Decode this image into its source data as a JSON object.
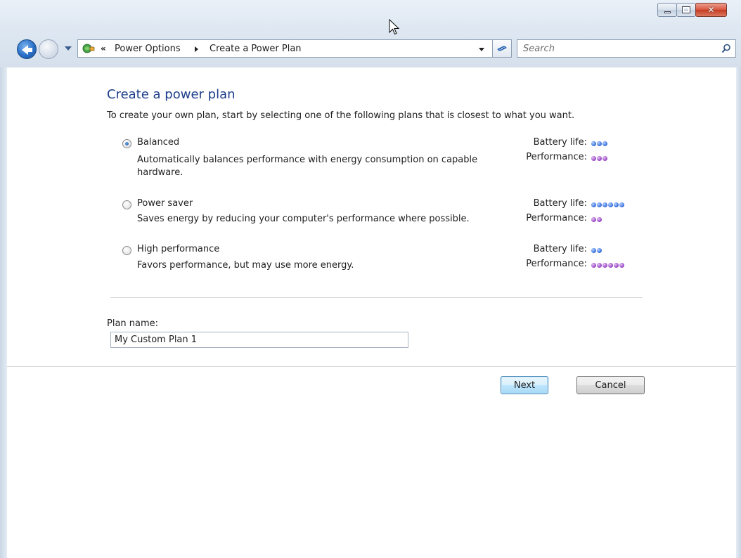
{
  "window": {
    "minimize_label": "minimize",
    "maximize_label": "maximize",
    "close_label": "close"
  },
  "address_bar": {
    "overflow_chevron": "«",
    "crumbs": [
      "Power Options",
      "Create a Power Plan"
    ]
  },
  "search": {
    "placeholder": "Search"
  },
  "page": {
    "heading": "Create a power plan",
    "intro": "To create your own plan, start by selecting one of the following plans that is closest to what you want."
  },
  "plans": [
    {
      "title": "Balanced",
      "selected": true,
      "description_line1": "Automatically balances performance with energy consumption on capable",
      "description_line2": "hardware.",
      "battery_label": "Battery life:",
      "performance_label": "Performance:",
      "battery_dots": 3,
      "performance_dots": 3
    },
    {
      "title": "Power saver",
      "selected": false,
      "description_line1": "Saves energy by reducing your computer's performance where possible.",
      "description_line2": "",
      "battery_label": "Battery life:",
      "performance_label": "Performance:",
      "battery_dots": 6,
      "performance_dots": 2
    },
    {
      "title": "High performance",
      "selected": false,
      "description_line1": "Favors performance, but may use more energy.",
      "description_line2": "",
      "battery_label": "Battery life:",
      "performance_label": "Performance:",
      "battery_dots": 2,
      "performance_dots": 6
    }
  ],
  "plan_name": {
    "label": "Plan name:",
    "value": "My Custom Plan 1"
  },
  "buttons": {
    "next": "Next",
    "cancel": "Cancel"
  },
  "colors": {
    "heading": "#1e3e8a",
    "battery_dot": "#3f77e0",
    "performance_dot": "#a150c9"
  }
}
